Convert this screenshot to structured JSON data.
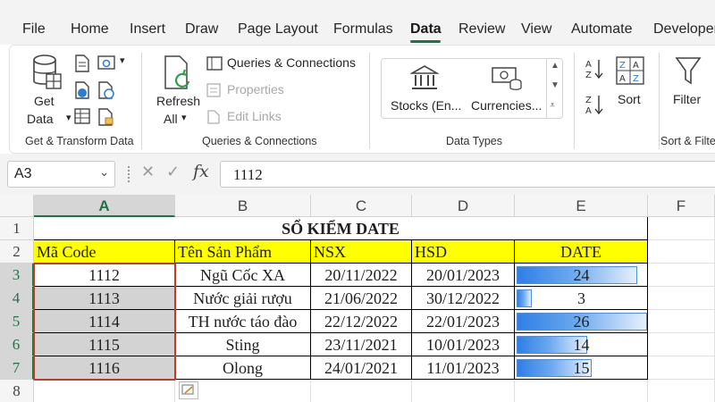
{
  "ribbon_tabs": [
    {
      "label": "File",
      "active": false
    },
    {
      "label": "Home",
      "active": false
    },
    {
      "label": "Insert",
      "active": false
    },
    {
      "label": "Draw",
      "active": false
    },
    {
      "label": "Page Layout",
      "active": false
    },
    {
      "label": "Formulas",
      "active": false
    },
    {
      "label": "Data",
      "active": true
    },
    {
      "label": "Review",
      "active": false
    },
    {
      "label": "View",
      "active": false
    },
    {
      "label": "Automate",
      "active": false
    },
    {
      "label": "Developer",
      "active": false
    }
  ],
  "ribbon": {
    "get_transform": {
      "get_data_line1": "Get",
      "get_data_line2": "Data",
      "group_label": "Get & Transform Data"
    },
    "queries": {
      "refresh_line1": "Refresh",
      "refresh_line2": "All",
      "queries_connections": "Queries & Connections",
      "properties": "Properties",
      "edit_links": "Edit Links",
      "group_label": "Queries & Connections"
    },
    "data_types": {
      "stocks": "Stocks (En...",
      "currencies": "Currencies...",
      "group_label": "Data Types"
    },
    "sort_filter": {
      "sort": "Sort",
      "filter": "Filter",
      "group_label": "Sort & Filte"
    }
  },
  "formula_bar": {
    "name_box": "A3",
    "formula": "1112"
  },
  "columns": [
    "A",
    "B",
    "C",
    "D",
    "E",
    "F"
  ],
  "rows": [
    "1",
    "2",
    "3",
    "4",
    "5",
    "6",
    "7",
    "8"
  ],
  "selected_column": "A",
  "sheet": {
    "title": "SỔ KIỂM DATE",
    "headers": [
      "Mã Code",
      "Tên Sản Phẩm",
      "NSX",
      "HSD",
      "DATE"
    ],
    "data": [
      {
        "code": "1112",
        "name": "Ngũ Cốc XA",
        "nsx": "20/11/2022",
        "hsd": "20/01/2023",
        "date": 24
      },
      {
        "code": "1113",
        "name": "Nước giải rượu",
        "nsx": "21/06/2022",
        "hsd": "30/12/2022",
        "date": 3
      },
      {
        "code": "1114",
        "name": "TH nước táo đào",
        "nsx": "22/12/2022",
        "hsd": "22/01/2023",
        "date": 26
      },
      {
        "code": "1115",
        "name": "Sting",
        "nsx": "23/11/2021",
        "hsd": "10/01/2023",
        "date": 14
      },
      {
        "code": "1116",
        "name": "Olong",
        "nsx": "24/01/2021",
        "hsd": "11/01/2023",
        "date": 15
      }
    ],
    "date_bar_max": 26
  },
  "colors": {
    "header_fill": "#ffff00",
    "selection_border": "#c0392b",
    "excel_green": "#217346"
  }
}
